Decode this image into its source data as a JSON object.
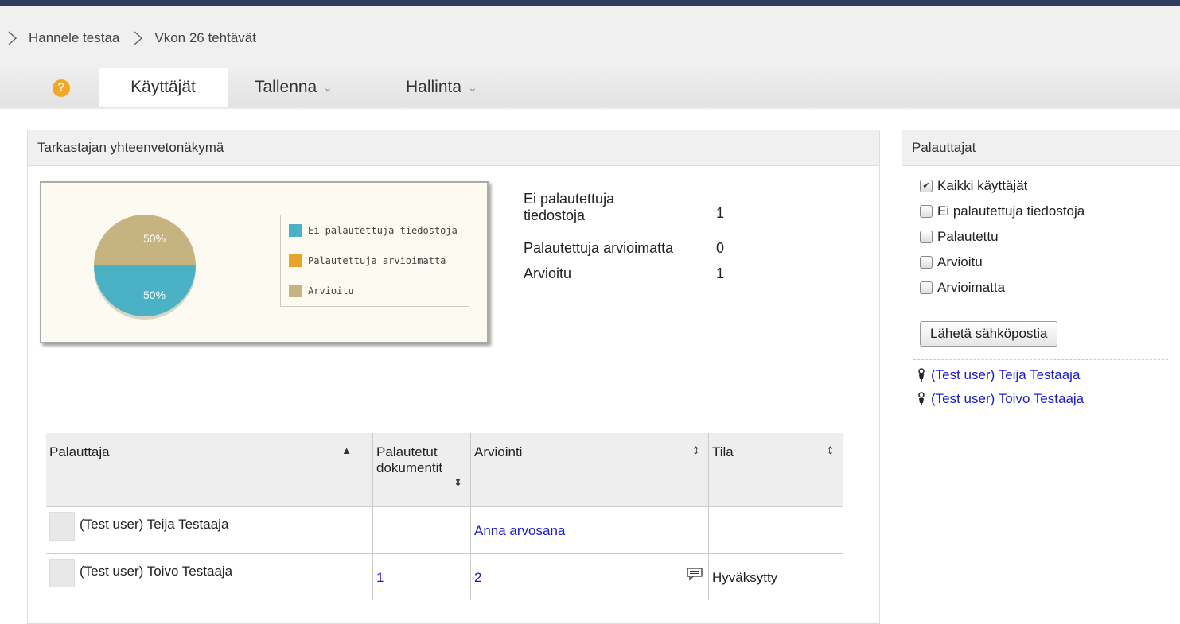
{
  "breadcrumb": [
    "Hannele testaa",
    "Vkon 26 tehtävät"
  ],
  "menu": {
    "help_icon": "help-icon",
    "tabs": [
      "Käyttäjät",
      "Tallenna",
      "Hallinta"
    ]
  },
  "summary": {
    "title": "Tarkastajan yhteenvetonäkymä",
    "stats": [
      {
        "label_line1": "Ei palautettuja",
        "label_line2": "tiedostoja",
        "value": "1"
      },
      {
        "label_line1": "Palautettuja arvioimatta",
        "value": "0"
      },
      {
        "label_line1": "Arvioitu",
        "value": "1"
      }
    ]
  },
  "chart_data": {
    "type": "pie",
    "legend": [
      "Ei palautettuja tiedostoja",
      "Palautettuja arvioimatta",
      "Arvioitu"
    ],
    "values": [
      50,
      0,
      50
    ],
    "slice_labels": [
      "50%",
      "50%"
    ],
    "colors": {
      "Ei palautettuja tiedostoja": "#4bb2c5",
      "Palautettuja arvioimatta": "#eaa228",
      "Arvioitu": "#c5b47f"
    },
    "legend_position": "right"
  },
  "table": {
    "headers": {
      "submitter": "Palauttaja",
      "docs_line1": "Palautetut",
      "docs_line2": "dokumentit",
      "grading": "Arviointi",
      "status": "Tila"
    },
    "rows": [
      {
        "name": "(Test user) Teija Testaaja",
        "docs": "",
        "grade": "Anna arvosana",
        "status": ""
      },
      {
        "name": "(Test user) Toivo Testaaja",
        "docs": "1",
        "grade": "2",
        "status": "Hyväksytty"
      }
    ]
  },
  "submitters": {
    "title": "Palauttajat",
    "filters": [
      {
        "label": "Kaikki käyttäjät",
        "checked": true
      },
      {
        "label": "Ei palautettuja tiedostoja",
        "checked": false
      },
      {
        "label": "Palautettu",
        "checked": false
      },
      {
        "label": "Arvioitu",
        "checked": false
      },
      {
        "label": "Arvioimatta",
        "checked": false
      }
    ],
    "email_button": "Lähetä sähköpostia",
    "users": [
      "(Test user) Teija Testaaja",
      "(Test user) Toivo Testaaja"
    ]
  }
}
